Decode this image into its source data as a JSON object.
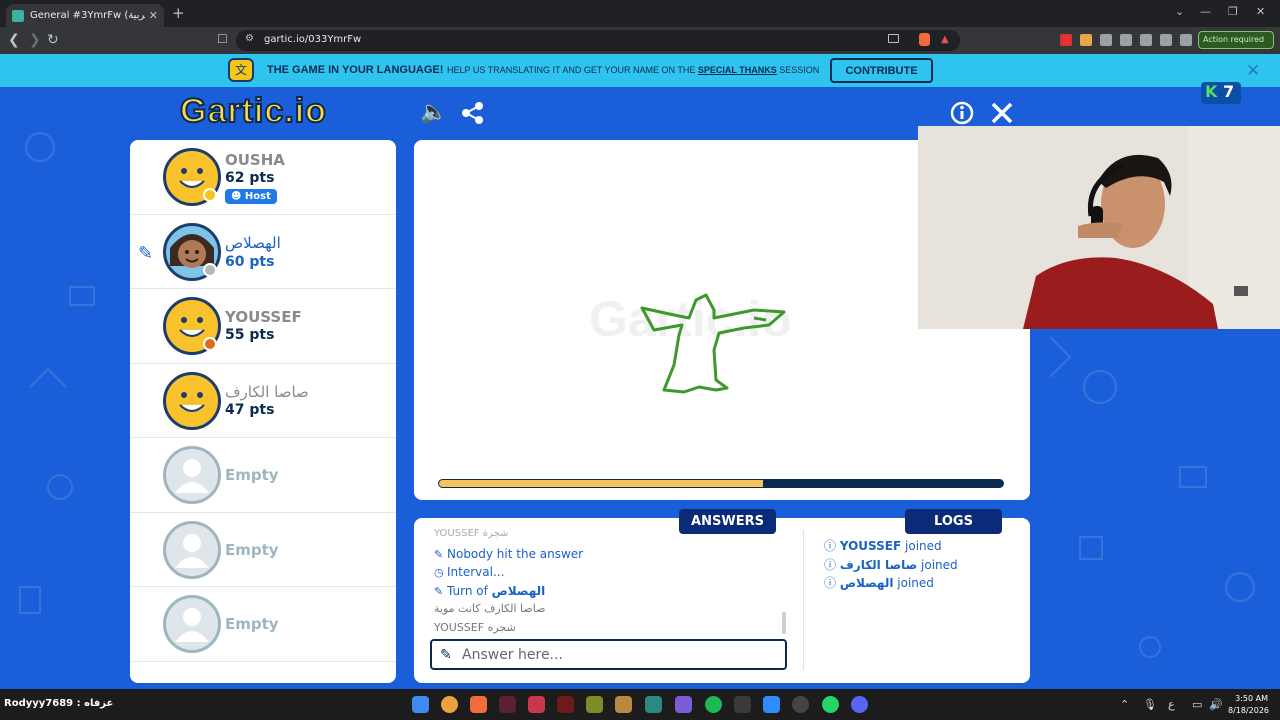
{
  "browser": {
    "tab_title": "General #3YmrFw (العربية) - Gart",
    "url": "gartic.io/033YmrFw",
    "action_required": "Action required"
  },
  "banner": {
    "headline": "THE GAME IN YOUR LANGUAGE!",
    "text_before": "HELP US TRANSLATING IT AND GET YOUR NAME ON THE",
    "text_link": "SPECIAL THANKS",
    "text_after": "SESSION",
    "contribute_label": "CONTRIBUTE"
  },
  "game": {
    "logo": "Gartic.io",
    "watermark": "Gartic.io",
    "k_badge": "7",
    "progress_fraction": 0.575
  },
  "players": [
    {
      "name": "OUSHA",
      "points": "62 pts",
      "badge": "Host",
      "drawing": false,
      "status_color": "#f5c518"
    },
    {
      "name": "الهصلاص",
      "points": "60 pts",
      "drawing": true,
      "status_color": "#b8b8b8"
    },
    {
      "name": "YOUSSEF",
      "points": "55 pts",
      "drawing": false,
      "status_color": "#e06a1b"
    },
    {
      "name": "صاصا الكارف",
      "points": "47 pts",
      "drawing": false
    }
  ],
  "empty_slots": [
    "Empty",
    "Empty",
    "Empty"
  ],
  "chat": {
    "answers_tab": "ANSWERS",
    "logs_tab": "LOGS",
    "messages": {
      "m0": "YOUSSEF شجرة",
      "m1": "Nobody hit the answer",
      "m2": "Interval...",
      "m3_prefix": "Turn of",
      "m3_name": "الهصلاص",
      "m4": "صاصا الكارف كانت موية",
      "m5_name": "YOUSSEF",
      "m5_text": "شجره"
    },
    "logs": [
      {
        "name": "YOUSSEF",
        "action": "joined"
      },
      {
        "name": "صاصا الكارف",
        "action": "joined"
      },
      {
        "name": "الهصلاص",
        "action": "joined"
      }
    ],
    "answer_placeholder": "Answer here..."
  },
  "taskbar": {
    "user_label": "Rodyyy7689 : عزفاه",
    "time": "3:50 AM",
    "date": "8/18/2026",
    "lang": "ع"
  },
  "colors": {
    "page_bg": "#1a5fd9",
    "banner_bg": "#2fc4f0",
    "navy": "#0b2a4f",
    "accent_blue": "#1b62c7",
    "progress": "#f5c45a",
    "drawing_green": "#3d9a2a"
  }
}
